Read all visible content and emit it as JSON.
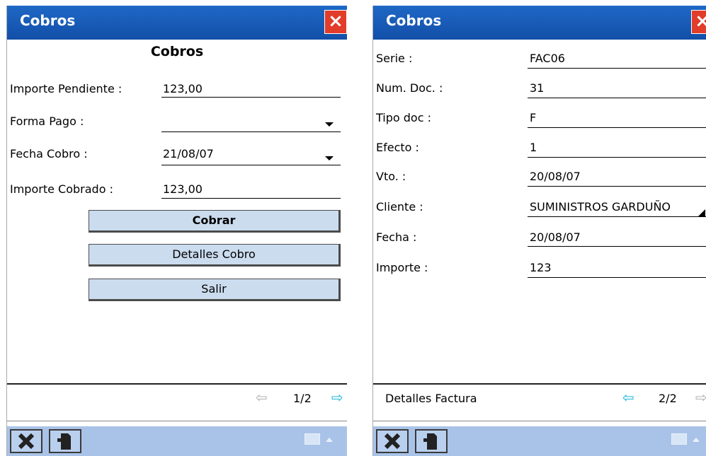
{
  "screen1": {
    "title": "Cobros",
    "close_icon": "×",
    "heading": "Cobros",
    "fields": {
      "importe_pendiente": {
        "label": "Importe Pendiente :",
        "value": "123,00"
      },
      "forma_pago": {
        "label": "Forma Pago :",
        "value": ""
      },
      "fecha_cobro": {
        "label": "Fecha Cobro :",
        "value": "21/08/07"
      },
      "importe_cobrado": {
        "label": "Importe Cobrado :",
        "value": "123,00"
      }
    },
    "buttons": {
      "cobrar": "Cobrar",
      "detalles": "Detalles Cobro",
      "salir": "Salir"
    },
    "pager": "1/2"
  },
  "screen2": {
    "title": "Cobros",
    "close_icon": "×",
    "fields": [
      {
        "label": "Serie :",
        "value": "FAC06"
      },
      {
        "label": "Num. Doc. :",
        "value": "31"
      },
      {
        "label": "Tipo doc :",
        "value": "F"
      },
      {
        "label": "Efecto :",
        "value": "1"
      },
      {
        "label": "Vto. :",
        "value": "20/08/07"
      },
      {
        "label": "Cliente :",
        "value": "SUMINISTROS GARDUÑO"
      },
      {
        "label": "Fecha :",
        "value": "20/08/07"
      },
      {
        "label": "Importe :",
        "value": "123"
      }
    ],
    "footer_label": "Detalles Factura",
    "pager": "2/2"
  },
  "icons": {
    "cancel": "x-icon",
    "document": "document-icon",
    "keyboard": "keyboard-icon",
    "prev": "arrow-left-icon",
    "next": "arrow-right-icon"
  },
  "colors": {
    "titlebar": "#1a5fbe",
    "button": "#cbdcef",
    "menubar": "#a9c3e8",
    "arrow_active": "#19b6d6"
  }
}
